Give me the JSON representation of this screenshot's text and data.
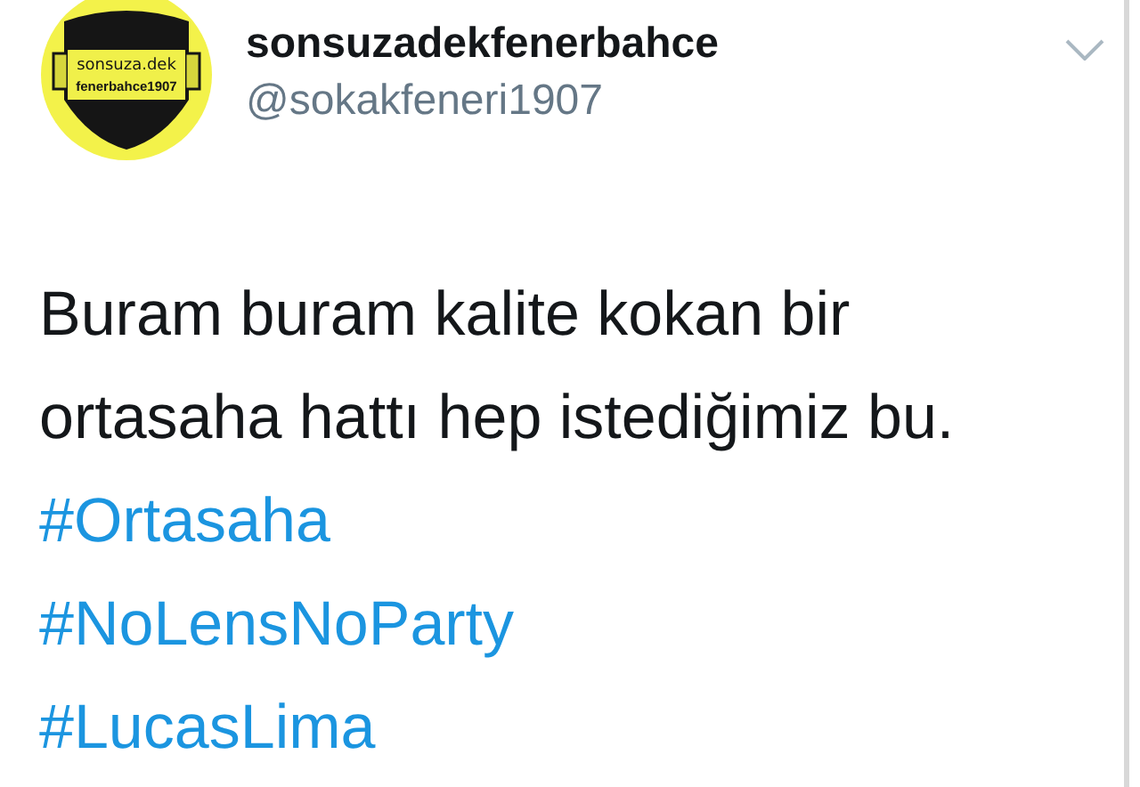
{
  "author": {
    "avatar_lines": [
      "sonsuza.dek",
      "fenerbahce1907"
    ],
    "name": "sonsuzadekfenerbahce",
    "handle": "@sokakfeneri1907"
  },
  "tweet": {
    "text_lines": [
      "Buram buram kalite kokan bir",
      "ortasaha hattı hep istediğimiz bu."
    ],
    "hashtags": [
      "#Ortasaha",
      "#NoLensNoParty",
      "#LucasLima"
    ]
  }
}
